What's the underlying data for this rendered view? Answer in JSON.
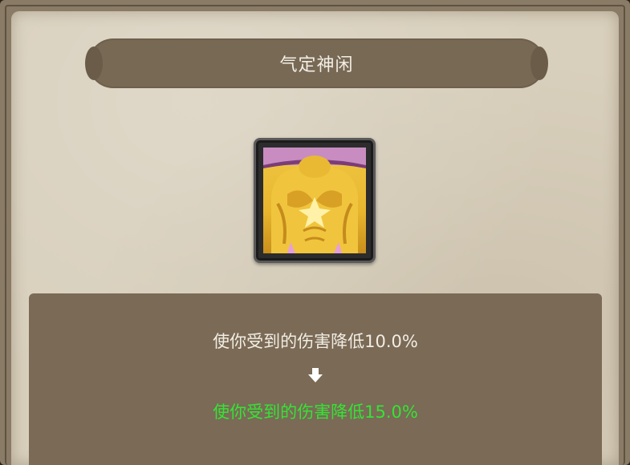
{
  "title": "气定神闲",
  "skill_icon": "golden-muscular-torso-icon",
  "description": {
    "before": "使你受到的伤害降低10.0%",
    "arrow_icon": "down-arrow-icon",
    "after": "使你受到的伤害降低15.0%"
  },
  "colors": {
    "frame": "#8a7b66",
    "parchment": "#d8cfbc",
    "panel": "#7a6a56",
    "before_text": "#f1ede3",
    "after_text": "#34e434"
  }
}
